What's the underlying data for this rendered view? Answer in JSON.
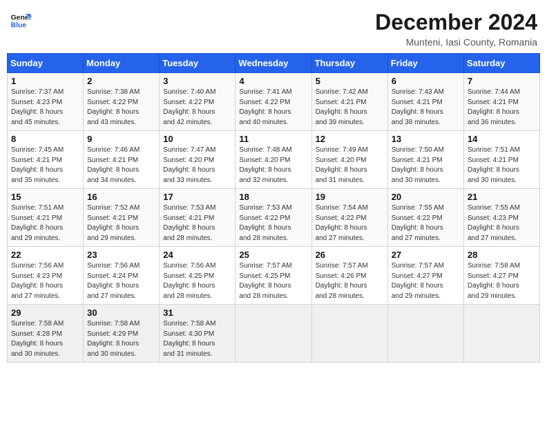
{
  "header": {
    "logo_line1": "General",
    "logo_line2": "Blue",
    "month": "December 2024",
    "location": "Munteni, Iasi County, Romania"
  },
  "weekdays": [
    "Sunday",
    "Monday",
    "Tuesday",
    "Wednesday",
    "Thursday",
    "Friday",
    "Saturday"
  ],
  "weeks": [
    [
      {
        "day": "1",
        "info": "Sunrise: 7:37 AM\nSunset: 4:23 PM\nDaylight: 8 hours\nand 45 minutes."
      },
      {
        "day": "2",
        "info": "Sunrise: 7:38 AM\nSunset: 4:22 PM\nDaylight: 8 hours\nand 43 minutes."
      },
      {
        "day": "3",
        "info": "Sunrise: 7:40 AM\nSunset: 4:22 PM\nDaylight: 8 hours\nand 42 minutes."
      },
      {
        "day": "4",
        "info": "Sunrise: 7:41 AM\nSunset: 4:22 PM\nDaylight: 8 hours\nand 40 minutes."
      },
      {
        "day": "5",
        "info": "Sunrise: 7:42 AM\nSunset: 4:21 PM\nDaylight: 8 hours\nand 39 minutes."
      },
      {
        "day": "6",
        "info": "Sunrise: 7:43 AM\nSunset: 4:21 PM\nDaylight: 8 hours\nand 38 minutes."
      },
      {
        "day": "7",
        "info": "Sunrise: 7:44 AM\nSunset: 4:21 PM\nDaylight: 8 hours\nand 36 minutes."
      }
    ],
    [
      {
        "day": "8",
        "info": "Sunrise: 7:45 AM\nSunset: 4:21 PM\nDaylight: 8 hours\nand 35 minutes."
      },
      {
        "day": "9",
        "info": "Sunrise: 7:46 AM\nSunset: 4:21 PM\nDaylight: 8 hours\nand 34 minutes."
      },
      {
        "day": "10",
        "info": "Sunrise: 7:47 AM\nSunset: 4:20 PM\nDaylight: 8 hours\nand 33 minutes."
      },
      {
        "day": "11",
        "info": "Sunrise: 7:48 AM\nSunset: 4:20 PM\nDaylight: 8 hours\nand 32 minutes."
      },
      {
        "day": "12",
        "info": "Sunrise: 7:49 AM\nSunset: 4:20 PM\nDaylight: 8 hours\nand 31 minutes."
      },
      {
        "day": "13",
        "info": "Sunrise: 7:50 AM\nSunset: 4:21 PM\nDaylight: 8 hours\nand 30 minutes."
      },
      {
        "day": "14",
        "info": "Sunrise: 7:51 AM\nSunset: 4:21 PM\nDaylight: 8 hours\nand 30 minutes."
      }
    ],
    [
      {
        "day": "15",
        "info": "Sunrise: 7:51 AM\nSunset: 4:21 PM\nDaylight: 8 hours\nand 29 minutes."
      },
      {
        "day": "16",
        "info": "Sunrise: 7:52 AM\nSunset: 4:21 PM\nDaylight: 8 hours\nand 29 minutes."
      },
      {
        "day": "17",
        "info": "Sunrise: 7:53 AM\nSunset: 4:21 PM\nDaylight: 8 hours\nand 28 minutes."
      },
      {
        "day": "18",
        "info": "Sunrise: 7:53 AM\nSunset: 4:22 PM\nDaylight: 8 hours\nand 28 minutes."
      },
      {
        "day": "19",
        "info": "Sunrise: 7:54 AM\nSunset: 4:22 PM\nDaylight: 8 hours\nand 27 minutes."
      },
      {
        "day": "20",
        "info": "Sunrise: 7:55 AM\nSunset: 4:22 PM\nDaylight: 8 hours\nand 27 minutes."
      },
      {
        "day": "21",
        "info": "Sunrise: 7:55 AM\nSunset: 4:23 PM\nDaylight: 8 hours\nand 27 minutes."
      }
    ],
    [
      {
        "day": "22",
        "info": "Sunrise: 7:56 AM\nSunset: 4:23 PM\nDaylight: 8 hours\nand 27 minutes."
      },
      {
        "day": "23",
        "info": "Sunrise: 7:56 AM\nSunset: 4:24 PM\nDaylight: 8 hours\nand 27 minutes."
      },
      {
        "day": "24",
        "info": "Sunrise: 7:56 AM\nSunset: 4:25 PM\nDaylight: 8 hours\nand 28 minutes."
      },
      {
        "day": "25",
        "info": "Sunrise: 7:57 AM\nSunset: 4:25 PM\nDaylight: 8 hours\nand 28 minutes."
      },
      {
        "day": "26",
        "info": "Sunrise: 7:57 AM\nSunset: 4:26 PM\nDaylight: 8 hours\nand 28 minutes."
      },
      {
        "day": "27",
        "info": "Sunrise: 7:57 AM\nSunset: 4:27 PM\nDaylight: 8 hours\nand 29 minutes."
      },
      {
        "day": "28",
        "info": "Sunrise: 7:58 AM\nSunset: 4:27 PM\nDaylight: 8 hours\nand 29 minutes."
      }
    ],
    [
      {
        "day": "29",
        "info": "Sunrise: 7:58 AM\nSunset: 4:28 PM\nDaylight: 8 hours\nand 30 minutes."
      },
      {
        "day": "30",
        "info": "Sunrise: 7:58 AM\nSunset: 4:29 PM\nDaylight: 8 hours\nand 30 minutes."
      },
      {
        "day": "31",
        "info": "Sunrise: 7:58 AM\nSunset: 4:30 PM\nDaylight: 8 hours\nand 31 minutes."
      },
      {
        "day": "",
        "info": ""
      },
      {
        "day": "",
        "info": ""
      },
      {
        "day": "",
        "info": ""
      },
      {
        "day": "",
        "info": ""
      }
    ]
  ]
}
